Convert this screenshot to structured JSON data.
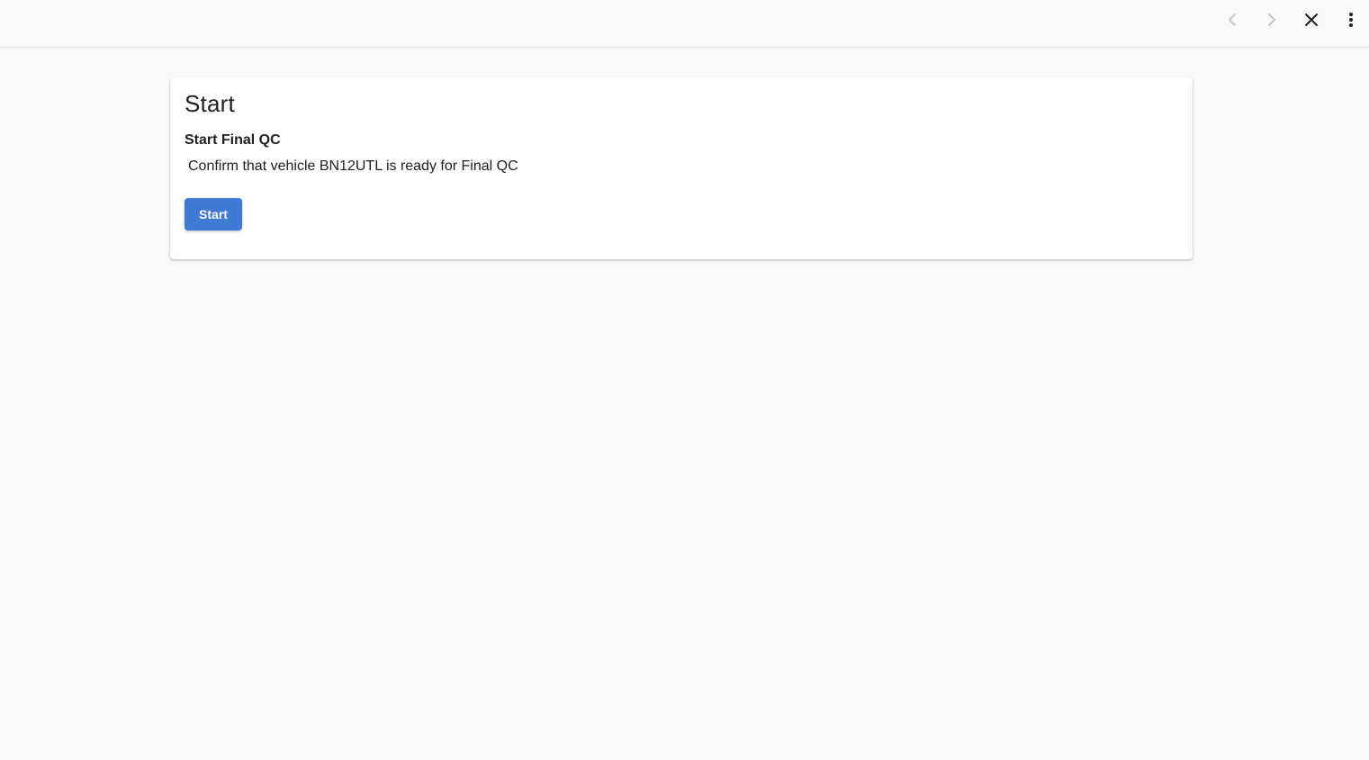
{
  "toolbar": {
    "icons": [
      "chevron-left-icon",
      "chevron-right-icon",
      "close-icon",
      "more-vert-icon"
    ],
    "icon_color": "#5f6368",
    "disabled_icon_color": "#bdbdbd"
  },
  "card": {
    "title": "Start",
    "step_title": "Start Final QC",
    "step_description": "Confirm that vehicle BN12UTL is ready for Final QC",
    "start_button_label": "Start",
    "accent_color": "#3f7ad6"
  }
}
